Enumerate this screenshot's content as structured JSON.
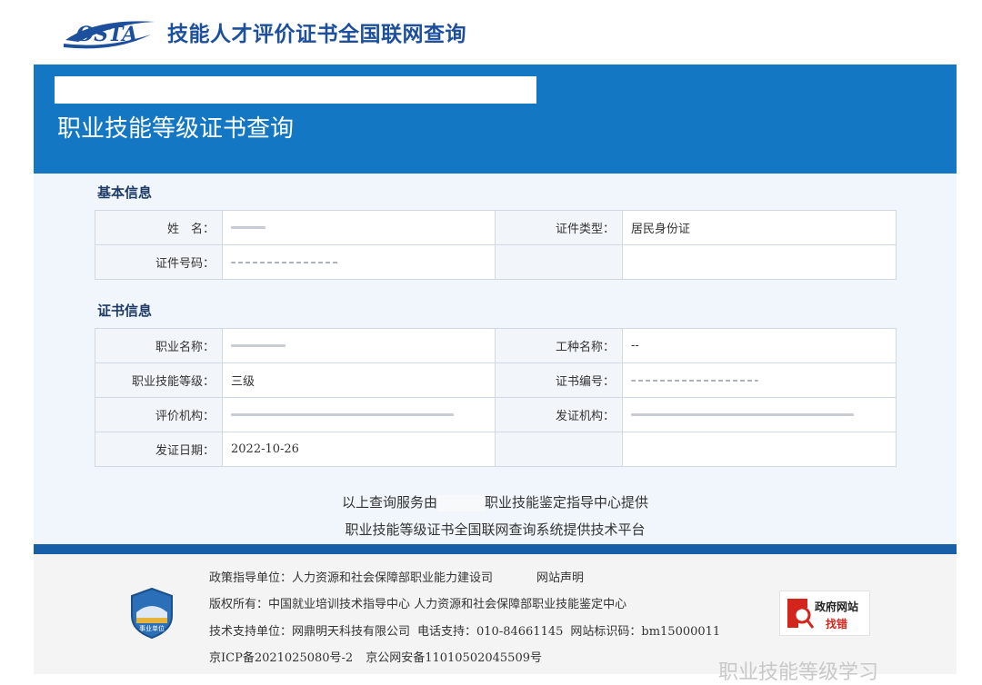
{
  "header": {
    "logo_text": "OSTA",
    "site_title": "技能人才评价证书全国联网查询"
  },
  "banner": {
    "title": "职业技能等级证书查询"
  },
  "basic_info": {
    "section_title": "基本信息",
    "name_label": "姓　名：",
    "id_type_label": "证件类型：",
    "id_type_value": "居民身份证",
    "id_number_label": "证件号码："
  },
  "cert_info": {
    "section_title": "证书信息",
    "occupation_label": "职业名称：",
    "job_type_label": "工种名称：",
    "job_type_value": "--",
    "level_label": "职业技能等级：",
    "level_value": "三级",
    "cert_no_label": "证书编号：",
    "eval_org_label": "评价机构：",
    "issue_org_label": "发证机构：",
    "issue_date_label": "发证日期：",
    "issue_date_value": "2022-10-26"
  },
  "provider": {
    "line1_prefix": "以上查询服务由",
    "line1_suffix": "职业技能鉴定指导中心提供",
    "line2": "职业技能等级证书全国联网查询系统提供技术平台"
  },
  "footer": {
    "policy": "政策指导单位：人力资源和社会保障部职业能力建设司",
    "statement_link": "网站声明",
    "copyright": "版权所有：中国就业培训技术指导中心 人力资源和社会保障部职业技能鉴定中心",
    "support": "技术支持单位：网鼎明天科技有限公司",
    "phone": "电话支持：010-84661145",
    "site_code": "网站标识码：bm15000011",
    "icp": "京ICP备2021025080号-2",
    "police": "京公网安备11010502045509号",
    "badge_text": "事业单位",
    "gov_line1": "政府网站",
    "gov_line2": "找错"
  },
  "watermark": "职业技能等级学习",
  "colors": {
    "banner_blue": "#1477c3",
    "footer_blue": "#1760a8",
    "title_blue": "#1c4f9c",
    "error_red": "#d4251d"
  }
}
